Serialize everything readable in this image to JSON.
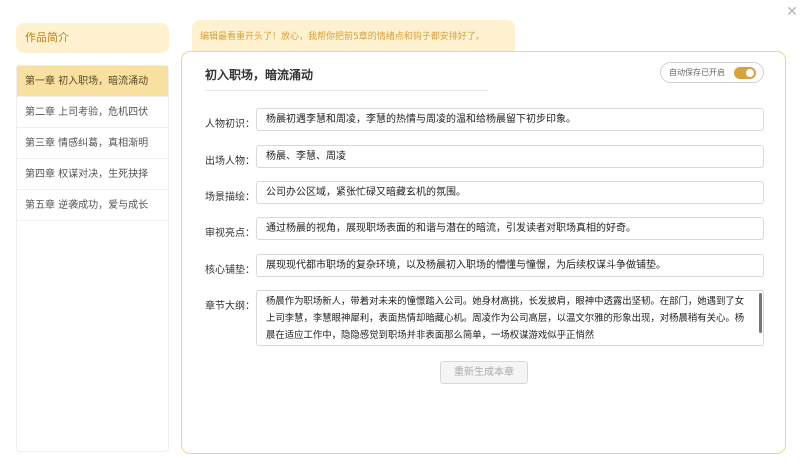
{
  "dialog": {
    "close_glyph": "✕"
  },
  "sidebar": {
    "heading": "作品简介",
    "chapters": [
      "第一章 初入职场，暗流涌动",
      "第二章 上司考验，危机四伏",
      "第三章 情感纠葛，真相渐明",
      "第四章 权谋对决，生死抉择",
      "第五章 逆袭成功，爱与成长"
    ],
    "active_index": 0
  },
  "notice": "编辑最看重开头了！放心，我帮你把前5章的情绪点和钩子都安排好了。",
  "main": {
    "chapter_title": "初入职场，暗流涌动",
    "autosave_label": "自动保存已开启",
    "autosave_on": true,
    "fields": [
      {
        "label": "人物初识：",
        "value": "杨晨初遇李慧和周凌，李慧的热情与周凌的温和给杨晨留下初步印象。"
      },
      {
        "label": "出场人物：",
        "value": "杨晨、李慧、周凌"
      },
      {
        "label": "场景描绘：",
        "value": "公司办公区域，紧张忙碌又暗藏玄机的氛围。"
      },
      {
        "label": "审视亮点：",
        "value": "通过杨晨的视角，展现职场表面的和谐与潜在的暗流，引发读者对职场真相的好奇。"
      },
      {
        "label": "核心铺垫：",
        "value": "展现现代都市职场的复杂环境，以及杨晨初入职场的懵懂与憧憬，为后续权谋斗争做铺垫。"
      }
    ],
    "outline": {
      "label": "章节大纲：",
      "value": "杨晨作为职场新人，带着对未来的憧憬踏入公司。她身材高挑，长发披肩，眼神中透露出坚韧。在部门，她遇到了女上司李慧，李慧眼神犀利，表面热情却暗藏心机。周凌作为公司高层，以温文尔雅的形象出现，对杨晨稍有关心。杨晨在适应工作中，隐隐感觉到职场并非表面那么简单，一场权谋游戏似乎正悄然"
    },
    "regenerate_label": "重新生成本章"
  }
}
